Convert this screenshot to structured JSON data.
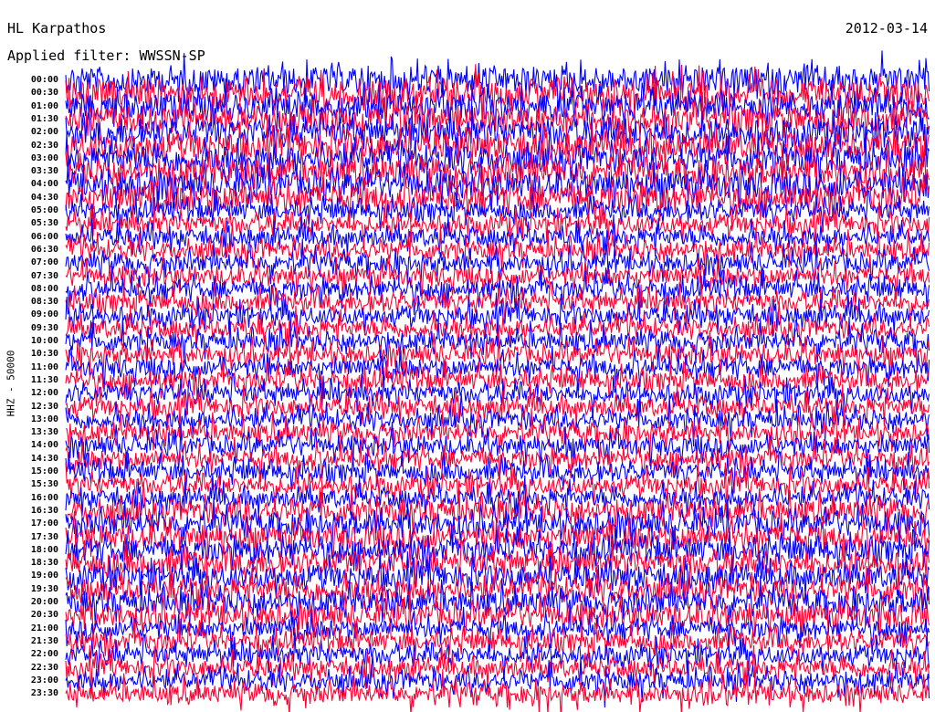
{
  "header": {
    "station": "HL Karpathos",
    "filter": "Applied filter: WWSSN-SP",
    "date": "2012-03-14"
  },
  "chart_data": {
    "type": "line",
    "title": "HL Karpathos",
    "date": "2012-03-14",
    "filter": "WWSSN-SP",
    "ylabel": "HHZ - 50000",
    "tick_labels": [
      "00:00",
      "00:30",
      "01:00",
      "01:30",
      "02:00",
      "02:30",
      "03:00",
      "03:30",
      "04:00",
      "04:30",
      "05:00",
      "05:30",
      "06:00",
      "06:30",
      "07:00",
      "07:30",
      "08:00",
      "08:30",
      "09:00",
      "09:30",
      "10:00",
      "10:30",
      "11:00",
      "11:30",
      "12:00",
      "12:30",
      "13:00",
      "13:30",
      "14:00",
      "14:30",
      "15:00",
      "15:30",
      "16:00",
      "16:30",
      "17:00",
      "17:30",
      "18:00",
      "18:30",
      "19:00",
      "19:30",
      "20:00",
      "20:30",
      "21:00",
      "21:30",
      "22:00",
      "22:30",
      "23:00",
      "23:30"
    ],
    "colors": [
      "#0000ff",
      "#ff0033"
    ],
    "grid": false
  }
}
